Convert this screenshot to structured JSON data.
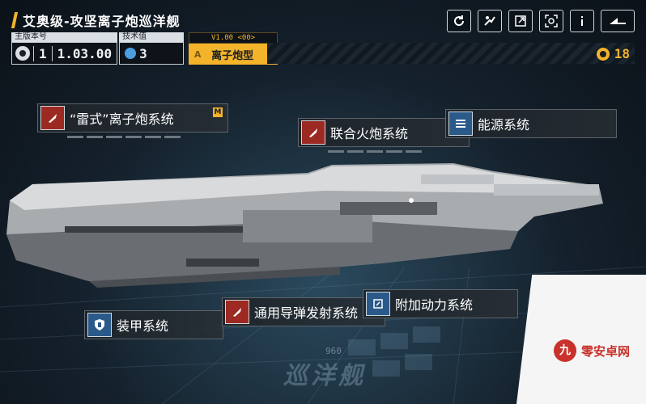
{
  "header": {
    "title": "艾奥级-攻坚离子炮巡洋舰"
  },
  "stats": {
    "version_label": "主版本号",
    "version_major": "1",
    "version_minor": "1.03.00",
    "tech_label": "技术值",
    "tech_value": "3",
    "type_top": "V1.00 <00>",
    "type_letter": "A",
    "type_value": "离子炮型"
  },
  "currency": {
    "value": "18"
  },
  "systems": {
    "ion_cannon": "“雷式”离子炮系统",
    "ion_badge": "M",
    "joint_cannon": "联合火炮系统",
    "energy": "能源系统",
    "armor": "装甲系统",
    "missile": "通用导弹发射系统",
    "aux_power": "附加动力系统"
  },
  "footer": {
    "ship_class": "巡洋舰",
    "deck_number": "960"
  },
  "watermark": {
    "logo": "九",
    "text": "零安卓网"
  },
  "icons": {
    "toolbar": [
      "refresh-icon",
      "transfer-icon",
      "external-icon",
      "view-icon",
      "info-icon",
      "back-icon"
    ]
  }
}
